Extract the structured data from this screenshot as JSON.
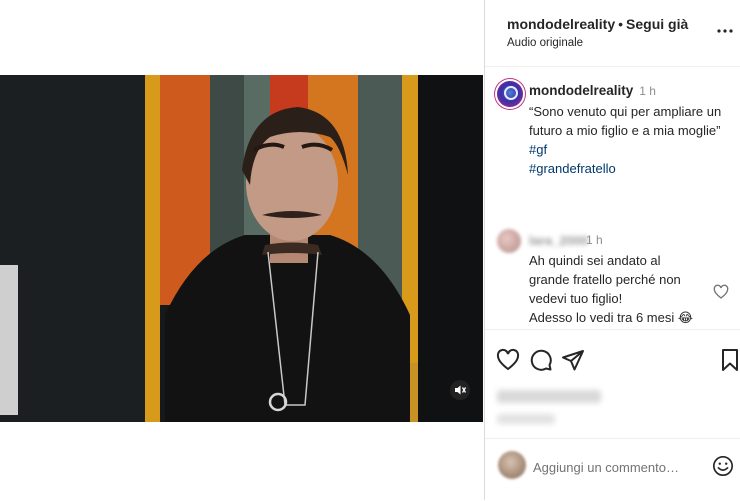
{
  "header": {
    "username": "mondodelreality",
    "separator": "•",
    "follow_status": "Segui già",
    "audio": "Audio originale",
    "more_icon": "more-horizontal-icon"
  },
  "caption": {
    "username": "mondodelreality",
    "time": "1 h",
    "text": "“Sono venuto qui per ampliare un futuro a mio figlio e a mia moglie”",
    "hashtags": [
      "#gf",
      "#grandefratello"
    ]
  },
  "comment": {
    "username": "lara_2000",
    "time": "1 h",
    "text": "Ah quindi sei andato al grande fratello perché non vedevi tuo figlio!",
    "text2": "Adesso lo vedi tra 6 mesi 😂"
  },
  "actions": {
    "icons": [
      "heart-icon",
      "comment-icon",
      "share-icon",
      "bookmark-icon"
    ]
  },
  "add_comment": {
    "placeholder": "Aggiungi un commento…"
  },
  "video": {
    "muted_icon": "volume-muted-icon"
  },
  "colors": {
    "hashtag": "#00376b",
    "text": "#262626",
    "muted": "#8e8e8e",
    "border": "#dbdbdb"
  }
}
